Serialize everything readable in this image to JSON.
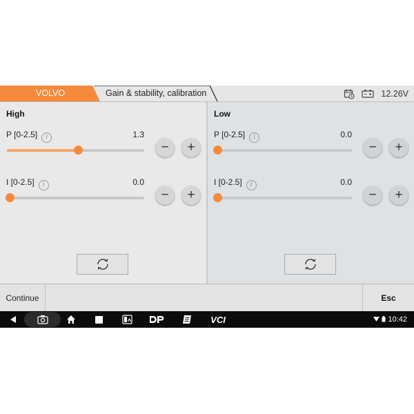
{
  "header": {
    "brand_tab": "VOLVO",
    "page_tab": "Gain & stability, calibration",
    "voltage": "12.26V",
    "icons": [
      "calendar-clock-icon",
      "battery-icon"
    ]
  },
  "panels": {
    "high": {
      "title": "High",
      "params": [
        {
          "label": "P [0-2.5]",
          "value": "1.3",
          "level": 1.3,
          "min": 0,
          "max": 2.5
        },
        {
          "label": "I [0-2.5]",
          "value": "0.0",
          "level": 0.0,
          "min": 0,
          "max": 2.5
        }
      ]
    },
    "low": {
      "title": "Low",
      "params": [
        {
          "label": "P [0-2.5]",
          "value": "0.0",
          "level": 0.0,
          "min": 0,
          "max": 2.5
        },
        {
          "label": "I [0-2.5]",
          "value": "0.0",
          "level": 0.0,
          "min": 0,
          "max": 2.5
        }
      ]
    }
  },
  "buttons": {
    "minus": "−",
    "plus": "+",
    "info": "i"
  },
  "bottom_bar": {
    "continue": "Continue",
    "esc": "Esc"
  },
  "nav_bar": {
    "vci": "VCI",
    "time": "10:42",
    "icons": [
      "back-icon",
      "camera-icon",
      "home-icon",
      "recent-apps-icon",
      "gallery-icon",
      "dp-icon",
      "notes-icon",
      "vci-icon",
      "wifi-icon",
      "battery-icon"
    ]
  },
  "colors": {
    "accent": "#f58a3c",
    "accent_light": "#f7a567",
    "panel_high_bg": "#e9e9e9",
    "panel_low_bg": "#dfe2e5"
  }
}
